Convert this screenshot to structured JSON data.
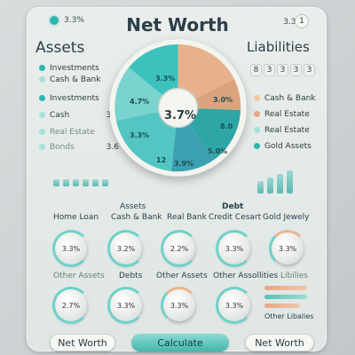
{
  "header": {
    "title": "Net Worth",
    "left_toggle_value": "3.3%",
    "right_value": "3.3%",
    "right_button": "1"
  },
  "assets": {
    "heading": "Assets",
    "items": [
      {
        "label": "Investments",
        "color": "#2bb7b0"
      },
      {
        "label": "Cash & Bank",
        "color": "#a7e0da"
      },
      {
        "label": "Investments",
        "color": "#2bb7b0"
      },
      {
        "label": "Cash",
        "color": "#a7e0da",
        "value": "3.5"
      },
      {
        "label": "Real Estate",
        "color": "#a7e0da"
      },
      {
        "label": "Bonds",
        "color": "#a7e0da",
        "value": "3.6"
      }
    ]
  },
  "liabilities": {
    "heading": "Liabilities",
    "chips": [
      "8",
      "3",
      "3",
      "3",
      "3"
    ],
    "items": [
      {
        "label": "Cash & Bank",
        "color": "#f0c9a7"
      },
      {
        "label": "Real Estate",
        "color": "#e9a684"
      },
      {
        "label": "Real Estate",
        "color": "#a7e0da"
      },
      {
        "label": "Gold Assets",
        "color": "#2bb7b0"
      }
    ]
  },
  "pie": {
    "center_label": "3.7%",
    "slice_labels": [
      "3.3%",
      "4.7%",
      "3.0%",
      "3.3%",
      "5.0%",
      "3.9%",
      "12",
      "8.0"
    ]
  },
  "columns": {
    "labels_top": [
      "Assets",
      "Debt"
    ],
    "labels": [
      "Home Loan",
      "Cash & Bank",
      "Real Bank",
      "Credit Cesart",
      "Gold Jewely"
    ]
  },
  "knobs_row1": [
    "3.3%",
    "3.2%",
    "2.2%",
    "3.3%",
    "3.3%"
  ],
  "row2_labels": [
    "Other Assets",
    "Debts",
    "Other Assets",
    "Other Assollities",
    "Libilies"
  ],
  "knobs_row2": [
    "2.7%",
    "3.3%",
    "3.3%",
    "3.3%"
  ],
  "side_label": "Other Libalies",
  "footer": {
    "net_worth_left": "Net Worth",
    "calculate": "Calculate",
    "net_worth_right": "Net Worth"
  }
}
